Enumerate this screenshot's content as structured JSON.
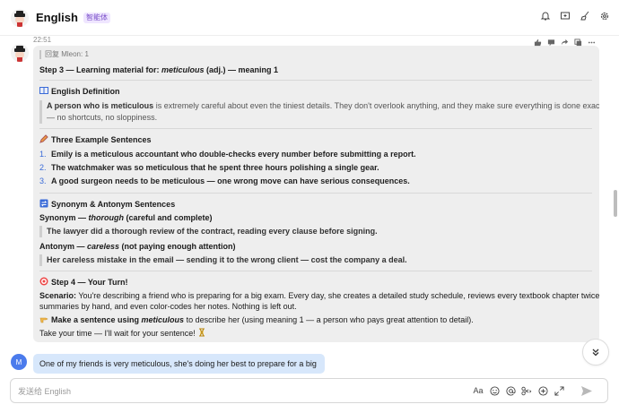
{
  "header": {
    "title": "English",
    "tag": "智能体"
  },
  "chat": {
    "timestamp": "22:51",
    "bot_message": {
      "reply_to": "回复 Mleon:  1",
      "step3_prefix": "Step 3 — Learning material for: ",
      "step3_word": "meticulous",
      "step3_suffix": " (adj.) — meaning 1",
      "definition_heading": "English Definition",
      "definition_bold": "A person who is meticulous",
      "definition_rest": " is extremely careful about even the tiniest details. They don't overlook anything, and they make sure everything is done exactly right",
      "definition_line2": "— no shortcuts, no sloppiness.",
      "examples_heading": "Three Example Sentences",
      "examples": [
        {
          "num": "1.",
          "text": "Emily is a meticulous accountant who double-checks every number before submitting a report."
        },
        {
          "num": "2.",
          "text": "The watchmaker was so meticulous that he spent three hours polishing a single gear."
        },
        {
          "num": "3.",
          "text": "A good surgeon needs to be meticulous — one wrong move can have serious consequences."
        }
      ],
      "syn_heading": "Synonym & Antonym Sentences",
      "synonym_label": "Synonym — ",
      "synonym_word": "thorough",
      "synonym_gloss": " (careful and complete)",
      "synonym_sentence": "The lawyer did a thorough review of the contract, reading every clause before signing.",
      "antonym_label": "Antonym — ",
      "antonym_word": "careless",
      "antonym_gloss": " (not paying enough attention)",
      "antonym_sentence": "Her careless mistake in the email — sending it to the wrong client — cost the company a deal.",
      "step4_heading": "Step 4 — Your Turn!",
      "scenario_label": "Scenario:",
      "scenario_line1": " You're describing a friend who is preparing for a big exam. Every day, she creates a detailed study schedule, reviews every textbook chapter twice, writes",
      "scenario_line2": "summaries by hand, and even color-codes her notes. Nothing is left out.",
      "task_bold_prefix": "Make a sentence using ",
      "task_word": "meticulous",
      "task_rest": " to describe her (using meaning 1 — a person who pays great attention to detail).",
      "closing": "Take your time — I'll wait for your sentence! "
    },
    "user_avatar_letter": "M",
    "user_message": "One of my friends is very meticulous, she's doing her best to prepare for a big exam."
  },
  "composer": {
    "placeholder": "发送给 English",
    "font_button": "Aa"
  },
  "colors": {
    "accent_purple": "#7a4fc9",
    "user_bubble": "#d7e7fb",
    "bot_bubble": "#eeeeee",
    "list_number": "#3a6bd8"
  },
  "icons": [
    "bell-icon",
    "new-chat-icon",
    "broom-icon",
    "settings-icon",
    "like-icon",
    "comment-icon",
    "share-icon",
    "copy-icon",
    "more-icon",
    "emoji-icon",
    "mention-icon",
    "scissors-icon",
    "plus-icon",
    "expand-icon",
    "send-icon",
    "chevron-down-icon"
  ]
}
